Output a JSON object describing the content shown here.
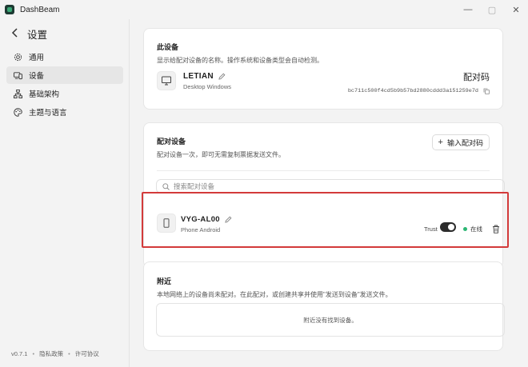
{
  "window": {
    "title": "DashBeam",
    "controls": [
      "—",
      "▢",
      "✕"
    ]
  },
  "sidebar": {
    "title": "设置",
    "items": [
      {
        "label": "通用",
        "icon": "gear-icon",
        "active": false
      },
      {
        "label": "设备",
        "icon": "devices-icon",
        "active": true
      },
      {
        "label": "基础架构",
        "icon": "network-icon",
        "active": false
      },
      {
        "label": "主题与语言",
        "icon": "palette-icon",
        "active": false
      }
    ],
    "footer": {
      "version": "v0.7.1",
      "privacy": "隐私政策",
      "license": "许可协议"
    }
  },
  "this_device": {
    "title": "此设备",
    "subtitle": "显示给配对设备的名称。操作系统和设备类型会自动检测。",
    "name": "LETIAN",
    "type": "Desktop Windows",
    "pair_code_label": "配对码",
    "pair_code": "bc711c500f4cd5b9b57bd2880cddd3a151259e7d"
  },
  "paired_devices": {
    "title": "配对设备",
    "subtitle": "配对设备一次，即可无需复制票据发送文件。",
    "enter_code_button": "输入配对码",
    "search_placeholder": "搜索配对设备",
    "devices": [
      {
        "name": "VYG-AL00",
        "type": "Phone Android",
        "trust_label": "Trust",
        "trusted": true,
        "status": "在线"
      }
    ]
  },
  "nearby": {
    "title": "附近",
    "subtitle": "本地网络上的设备尚未配对。在此配对，或创建共享并使用\"发送到设备\"发送文件。",
    "empty_text": "附近没有找到设备。"
  },
  "colors": {
    "online": "#2bb673",
    "highlight": "#d33a3a"
  }
}
